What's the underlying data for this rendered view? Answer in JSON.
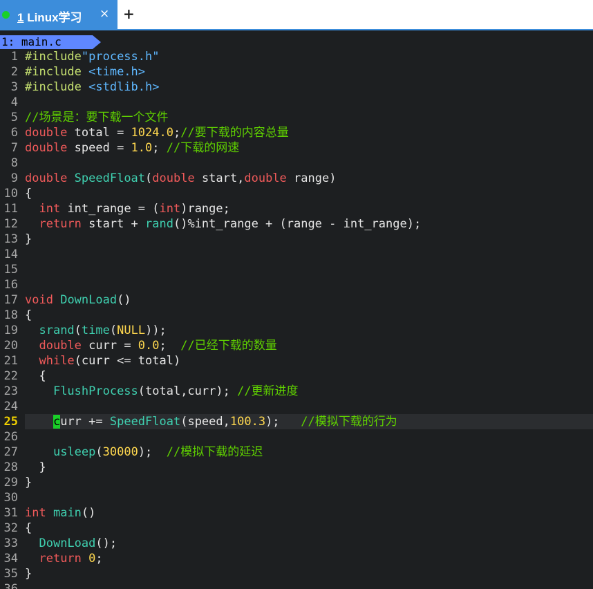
{
  "tab": {
    "number": "1",
    "title": "Linux学习",
    "close": "×",
    "add": "+"
  },
  "buffer": {
    "label": "1: main.c"
  },
  "cursor_line": 25,
  "lines": [
    [
      [
        "pp",
        "#include"
      ],
      [
        "str",
        "\"process.h\""
      ]
    ],
    [
      [
        "pp",
        "#include "
      ],
      [
        "str",
        "<time.h>"
      ]
    ],
    [
      [
        "pp",
        "#include "
      ],
      [
        "str",
        "<stdlib.h>"
      ]
    ],
    [],
    [
      [
        "cm",
        "//场景是：要下载一个文件"
      ]
    ],
    [
      [
        "kw",
        "double"
      ],
      [
        "pl",
        " total = "
      ],
      [
        "num",
        "1024.0"
      ],
      [
        "pl",
        ";"
      ],
      [
        "cm",
        "//要下载的内容总量"
      ]
    ],
    [
      [
        "kw",
        "double"
      ],
      [
        "pl",
        " speed = "
      ],
      [
        "num",
        "1.0"
      ],
      [
        "pl",
        "; "
      ],
      [
        "cm",
        "//下载的网速"
      ]
    ],
    [],
    [
      [
        "kw",
        "double"
      ],
      [
        "pl",
        " "
      ],
      [
        "fn",
        "SpeedFloat"
      ],
      [
        "pl",
        "("
      ],
      [
        "kw",
        "double"
      ],
      [
        "pl",
        " start,"
      ],
      [
        "kw",
        "double"
      ],
      [
        "pl",
        " range)"
      ]
    ],
    [
      [
        "pl",
        "{"
      ]
    ],
    [
      [
        "pl",
        "  "
      ],
      [
        "kw",
        "int"
      ],
      [
        "pl",
        " int_range = ("
      ],
      [
        "kw",
        "int"
      ],
      [
        "pl",
        ")range;"
      ]
    ],
    [
      [
        "pl",
        "  "
      ],
      [
        "kw",
        "return"
      ],
      [
        "pl",
        " start + "
      ],
      [
        "fn",
        "rand"
      ],
      [
        "pl",
        "()%int_range + (range - int_range);"
      ]
    ],
    [
      [
        "pl",
        "}"
      ]
    ],
    [],
    [],
    [],
    [
      [
        "kw",
        "void"
      ],
      [
        "pl",
        " "
      ],
      [
        "fn",
        "DownLoad"
      ],
      [
        "pl",
        "()"
      ]
    ],
    [
      [
        "pl",
        "{"
      ]
    ],
    [
      [
        "pl",
        "  "
      ],
      [
        "fn",
        "srand"
      ],
      [
        "pl",
        "("
      ],
      [
        "fn",
        "time"
      ],
      [
        "pl",
        "("
      ],
      [
        "nl",
        "NULL"
      ],
      [
        "pl",
        "));"
      ]
    ],
    [
      [
        "pl",
        "  "
      ],
      [
        "kw",
        "double"
      ],
      [
        "pl",
        " curr = "
      ],
      [
        "num",
        "0.0"
      ],
      [
        "pl",
        ";  "
      ],
      [
        "cm",
        "//已经下载的数量"
      ]
    ],
    [
      [
        "pl",
        "  "
      ],
      [
        "kw",
        "while"
      ],
      [
        "pl",
        "(curr <= total)"
      ]
    ],
    [
      [
        "pl",
        "  {"
      ]
    ],
    [
      [
        "pl",
        "    "
      ],
      [
        "fn",
        "FlushProcess"
      ],
      [
        "pl",
        "(total,curr); "
      ],
      [
        "cm",
        "//更新进度"
      ]
    ],
    [],
    [
      [
        "pl",
        "    "
      ],
      [
        "cur",
        "c"
      ],
      [
        "pl",
        "urr += "
      ],
      [
        "fn",
        "SpeedFloat"
      ],
      [
        "pl",
        "(speed,"
      ],
      [
        "num",
        "100.3"
      ],
      [
        "pl",
        ");   "
      ],
      [
        "cm",
        "//模拟下载的行为"
      ]
    ],
    [],
    [
      [
        "pl",
        "    "
      ],
      [
        "fn",
        "usleep"
      ],
      [
        "pl",
        "("
      ],
      [
        "num",
        "30000"
      ],
      [
        "pl",
        ");  "
      ],
      [
        "cm",
        "//模拟下载的延迟"
      ]
    ],
    [
      [
        "pl",
        "  }"
      ]
    ],
    [
      [
        "pl",
        "}"
      ]
    ],
    [],
    [
      [
        "kw",
        "int"
      ],
      [
        "pl",
        " "
      ],
      [
        "fn",
        "main"
      ],
      [
        "pl",
        "()"
      ]
    ],
    [
      [
        "pl",
        "{"
      ]
    ],
    [
      [
        "pl",
        "  "
      ],
      [
        "fn",
        "DownLoad"
      ],
      [
        "pl",
        "();"
      ]
    ],
    [
      [
        "pl",
        "  "
      ],
      [
        "kw",
        "return"
      ],
      [
        "pl",
        " "
      ],
      [
        "num",
        "0"
      ],
      [
        "pl",
        ";"
      ]
    ],
    [
      [
        "pl",
        "}"
      ]
    ],
    []
  ]
}
